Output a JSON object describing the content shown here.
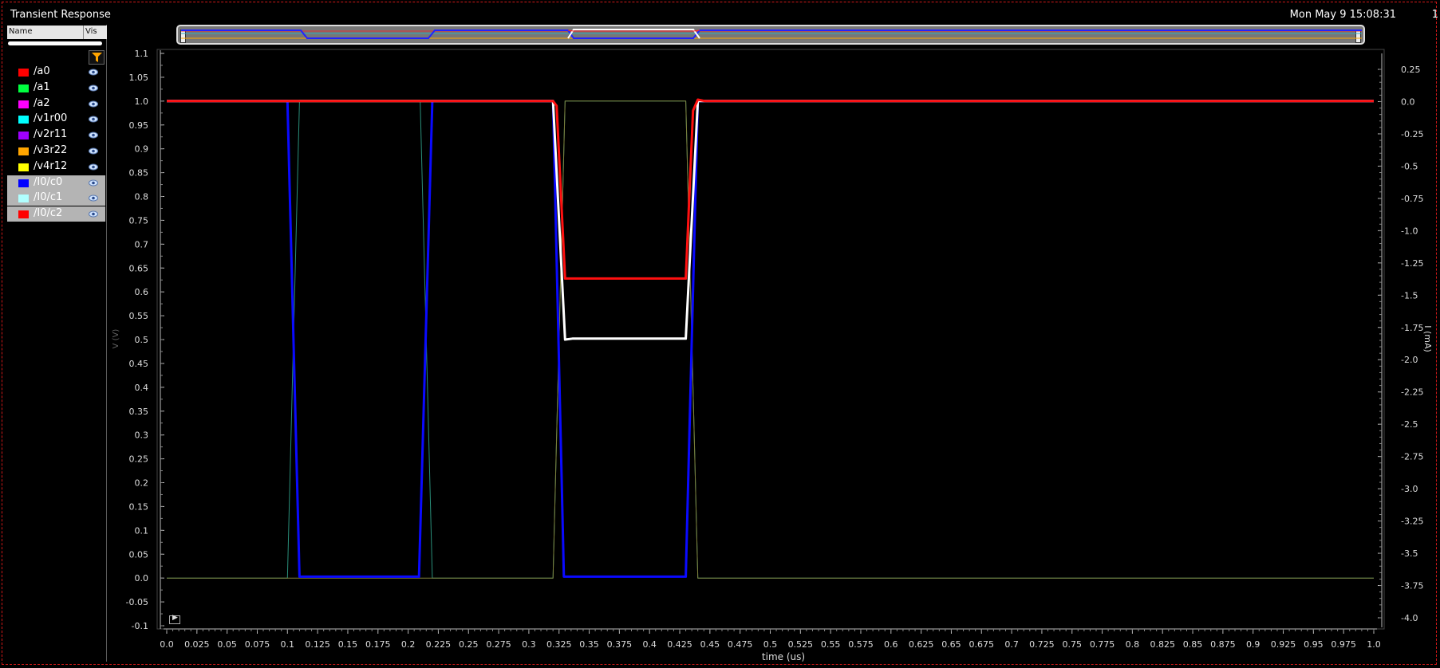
{
  "window": {
    "title": "Transient Response",
    "datetime": "Mon May 9 15:08:31",
    "corner_num": "1"
  },
  "browser": {
    "col_name": "Name",
    "col_vis": "Vis",
    "signals": [
      {
        "name": "/a0",
        "color": "#ff0000",
        "selected": false
      },
      {
        "name": "/a1",
        "color": "#00ff40",
        "selected": false
      },
      {
        "name": "/a2",
        "color": "#ff00ff",
        "selected": false
      },
      {
        "name": "/v1r00",
        "color": "#00ffff",
        "selected": false
      },
      {
        "name": "/v2r11",
        "color": "#a000ff",
        "selected": false
      },
      {
        "name": "/v3r22",
        "color": "#ffa500",
        "selected": false
      },
      {
        "name": "/v4r12",
        "color": "#ffff00",
        "selected": false
      },
      {
        "name": "/I0/c0",
        "color": "#0000ff",
        "selected": true
      },
      {
        "name": "/I0/c1",
        "color": "#b0ffff",
        "selected": true
      },
      {
        "name": "/I0/c2",
        "color": "#ff0000",
        "selected": true
      }
    ],
    "icons": {
      "filter": "filter-icon",
      "visibility": "eye-icon"
    }
  },
  "chart_data": {
    "type": "line",
    "xlabel": "time (us)",
    "ylabel_left": "V (V)",
    "ylabel_right": "I (mA)",
    "xlim": [
      0.0,
      1.0
    ],
    "ylim_left": [
      -0.1,
      1.1
    ],
    "ylim_right": [
      -4.0,
      0.25
    ],
    "x_ticks": [
      "0.0",
      "0.025",
      "0.05",
      "0.075",
      "0.1",
      "0.125",
      "0.15",
      "0.175",
      "0.2",
      "0.225",
      "0.25",
      "0.275",
      "0.3",
      "0.325",
      "0.35",
      "0.375",
      "0.4",
      "0.425",
      "0.45",
      "0.475",
      "0.5",
      "0.525",
      "0.55",
      "0.575",
      "0.6",
      "0.625",
      "0.65",
      "0.675",
      "0.7",
      "0.725",
      "0.75",
      "0.775",
      "0.8",
      "0.825",
      "0.85",
      "0.875",
      "0.9",
      "0.925",
      "0.95",
      "0.975",
      "1.0"
    ],
    "y_left_ticks": [
      "1.1",
      "1.05",
      "1.0",
      "0.95",
      "0.9",
      "0.85",
      "0.8",
      "0.75",
      "0.7",
      "0.65",
      "0.6",
      "0.55",
      "0.5",
      "0.45",
      "0.4",
      "0.35",
      "0.3",
      "0.25",
      "0.2",
      "0.15",
      "0.1",
      "0.05",
      "0.0",
      "-0.05",
      "-0.1"
    ],
    "y_right_ticks": [
      "0.25",
      "0.0",
      "-0.25",
      "-0.5",
      "-0.75",
      "-1.0",
      "-1.25",
      "-1.5",
      "-1.75",
      "-2.0",
      "-2.25",
      "-2.5",
      "-2.75",
      "-3.0",
      "-3.25",
      "-3.5",
      "-3.75",
      "-4.0"
    ],
    "series": [
      {
        "color": "#2a8f7a",
        "axis": "left",
        "width": 1,
        "points": [
          [
            0,
            0
          ],
          [
            0.1,
            0
          ],
          [
            0.11,
            1
          ],
          [
            0.21,
            1
          ],
          [
            0.22,
            0
          ],
          [
            0.32,
            0
          ],
          [
            0.33,
            1
          ],
          [
            0.43,
            1
          ],
          [
            0.44,
            0
          ],
          [
            1.0,
            0
          ]
        ]
      },
      {
        "color": "#7f7f3a",
        "axis": "left",
        "width": 1,
        "points": [
          [
            0,
            0
          ],
          [
            0.32,
            0
          ],
          [
            0.33,
            1
          ],
          [
            0.43,
            1
          ],
          [
            0.44,
            0
          ],
          [
            1.0,
            0
          ]
        ]
      },
      {
        "color": "#777777",
        "axis": "left",
        "width": 1,
        "points": [
          [
            0.11,
            1.002
          ],
          [
            0.21,
            1.002
          ]
        ]
      },
      {
        "color": "#0a0aff",
        "axis": "left",
        "width": 3,
        "points": [
          [
            0,
            1
          ],
          [
            0.1,
            1
          ],
          [
            0.11,
            0.003
          ],
          [
            0.209,
            0.003
          ],
          [
            0.22,
            1
          ],
          [
            0.32,
            1
          ],
          [
            0.329,
            0.003
          ],
          [
            0.43,
            0.003
          ],
          [
            0.44,
            1
          ],
          [
            1.0,
            1
          ]
        ]
      },
      {
        "color": "#ffffff",
        "axis": "left",
        "width": 3,
        "points": [
          [
            0,
            1
          ],
          [
            0.32,
            1
          ],
          [
            0.33,
            0.5
          ],
          [
            0.336,
            0.502
          ],
          [
            0.43,
            0.502
          ],
          [
            0.44,
            1
          ],
          [
            1.0,
            1
          ]
        ]
      },
      {
        "color": "#ff1010",
        "axis": "left",
        "width": 3,
        "points": [
          [
            0,
            1
          ],
          [
            0.32,
            1
          ],
          [
            0.323,
            0.99
          ],
          [
            0.33,
            0.628
          ],
          [
            0.43,
            0.628
          ],
          [
            0.436,
            0.98
          ],
          [
            0.44,
            1.003
          ],
          [
            0.446,
            1
          ],
          [
            1.0,
            1
          ]
        ]
      }
    ]
  }
}
